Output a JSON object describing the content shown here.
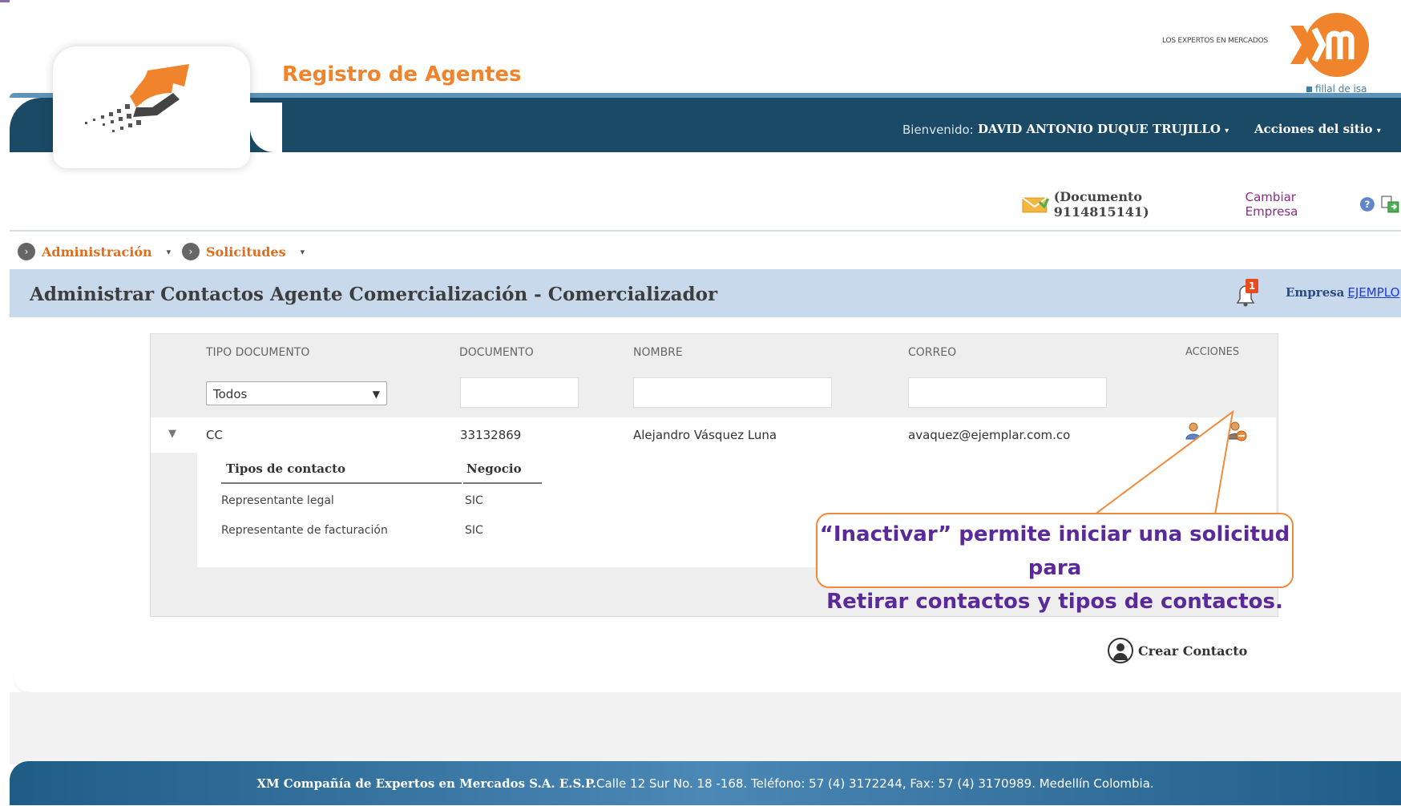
{
  "header": {
    "app_title": "Registro de Agentes",
    "brand_tagline": "LOS EXPERTOS EN MERCADOS",
    "brand_subtitle": "filial de isa",
    "welcome_label": "Bienvenido:",
    "user_name": "DAVID ANTONIO DUQUE TRUJILLO",
    "site_actions": "Acciones del sitio"
  },
  "document": {
    "number_text": "(Documento 9114815141)",
    "change_company": "Cambiar Empresa"
  },
  "breadcrumb": {
    "items": [
      {
        "label": "Administración"
      },
      {
        "label": "Solicitudes"
      }
    ]
  },
  "title_bar": {
    "title": "Administrar Contactos Agente Comercialización - Comercializador",
    "notification_count": "1",
    "empresa_label": "Empresa",
    "empresa_value": "EJEMPLO"
  },
  "table": {
    "headers": [
      "TIPO DOCUMENTO",
      "DOCUMENTO",
      "NOMBRE",
      "CORREO",
      "ACCIONES"
    ],
    "filter_select_value": "Todos",
    "row": {
      "tipo": "CC",
      "documento": "33132869",
      "nombre": "Alejandro Vásquez Luna",
      "correo": "avaquez@ejemplar.com.co"
    },
    "sub_headers": [
      "Tipos de contacto",
      "Negocio"
    ],
    "sub_rows": [
      {
        "tipo": "Representante legal",
        "negocio": "SIC"
      },
      {
        "tipo": "Representante de facturación",
        "negocio": "SIC"
      }
    ]
  },
  "callout": {
    "line1": "“Inactivar” permite iniciar una solicitud para",
    "line2": "Retirar contactos y tipos de contactos."
  },
  "actions": {
    "create_contact": "Crear Contacto"
  },
  "footer": {
    "company": "XM Compañía de Expertos en Mercados S.A. E.S.P.",
    "address": "Calle 12 Sur No. 18 -168. Teléfono: 57 (4) 3172244, Fax: 57 (4) 3170989. Medellín Colombia."
  },
  "colors": {
    "brand_orange": "#f0842c",
    "header_blue": "#1a4a66",
    "title_bar": "#c8d9ec",
    "callout_text": "#5a2a9a",
    "callout_border": "#f08a3c"
  }
}
